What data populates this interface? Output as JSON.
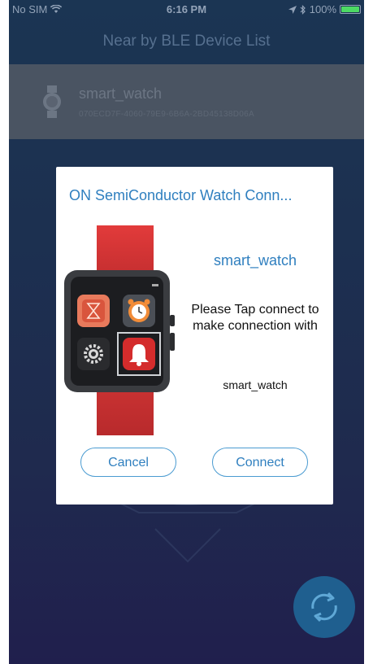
{
  "status_bar": {
    "carrier": "No SIM",
    "time": "6:16 PM",
    "battery": "100%",
    "battery_level": 1.0
  },
  "nav": {
    "title": "Near by BLE Device List"
  },
  "device_list": [
    {
      "name": "smart_watch",
      "uuid": "070ECD7F-4060-79E9-6B6A-2BD45138D06A"
    }
  ],
  "dialog": {
    "title": "ON SemiConductor Watch Conn...",
    "device_name": "smart_watch",
    "message": "Please Tap connect to make connection with",
    "target_name": "smart_watch",
    "cancel_label": "Cancel",
    "connect_label": "Connect"
  },
  "colors": {
    "accent": "#2f7fbf",
    "background_top": "#1b3553",
    "background_bottom": "#201f4d",
    "watch_band": "#d63a3a"
  },
  "icons": {
    "wifi": "wifi-icon",
    "location": "location-arrow-icon",
    "bluetooth": "bluetooth-icon",
    "watch": "watch-icon",
    "refresh": "refresh-icon"
  }
}
